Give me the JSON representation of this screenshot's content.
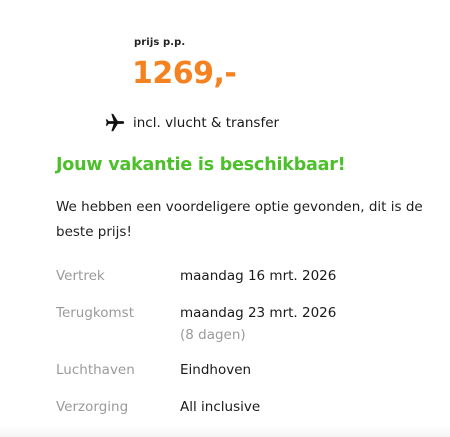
{
  "price": {
    "label": "prijs p.p.",
    "amount": "1269,-",
    "accent_color": "#f58220"
  },
  "inclusion": {
    "icon": "airplane-icon",
    "text": "incl. vlucht & transfer"
  },
  "availability": {
    "headline": "Jouw vakantie is beschikbaar!",
    "headline_color": "#4cc02a",
    "message": "We hebben een voordeligere optie gevonden, dit is de beste prijs!"
  },
  "details": {
    "departure": {
      "label": "Vertrek",
      "value": "maandag 16 mrt. 2026"
    },
    "return": {
      "label": "Terugkomst",
      "value": "maandag 23 mrt. 2026",
      "duration": "(8 dagen)"
    },
    "airport": {
      "label": "Luchthaven",
      "value": "Eindhoven"
    },
    "board": {
      "label": "Verzorging",
      "value": "All inclusive"
    }
  }
}
